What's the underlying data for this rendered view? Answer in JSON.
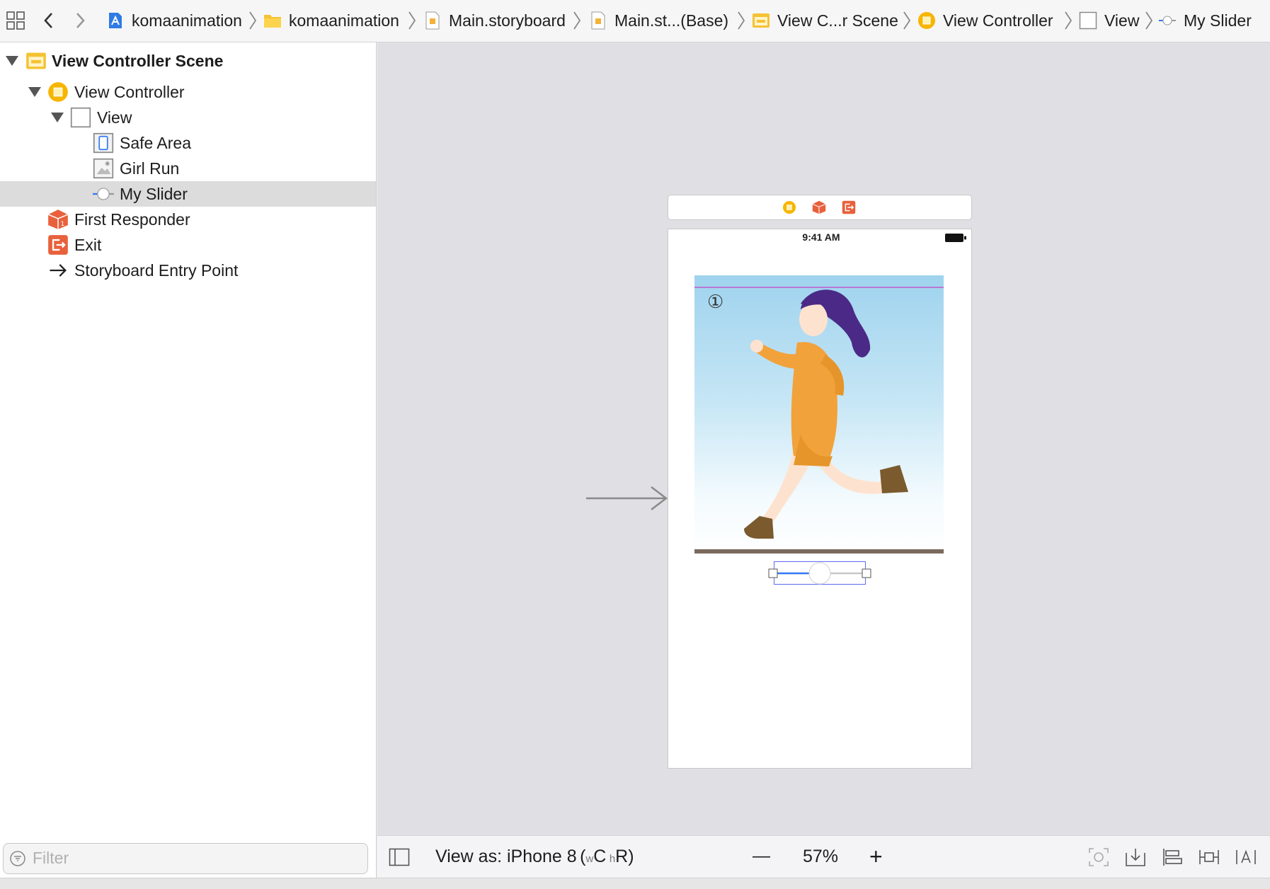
{
  "breadcrumbs": [
    {
      "label": "komaanimation",
      "icon": "xcode-project-icon"
    },
    {
      "label": "komaanimation",
      "icon": "folder-icon"
    },
    {
      "label": "Main.storyboard",
      "icon": "storyboard-file-icon"
    },
    {
      "label": "Main.st...(Base)",
      "icon": "storyboard-file-icon"
    },
    {
      "label": "View C...r Scene",
      "icon": "scene-icon"
    },
    {
      "label": "View Controller",
      "icon": "view-controller-icon"
    },
    {
      "label": "View",
      "icon": "view-icon"
    },
    {
      "label": "My Slider",
      "icon": "slider-icon"
    }
  ],
  "outline": {
    "items": [
      {
        "label": "View Controller Scene",
        "icon": "scene-icon",
        "expanded": true
      },
      {
        "label": "View Controller",
        "icon": "view-controller-icon",
        "expanded": true
      },
      {
        "label": "View",
        "icon": "view-icon",
        "expanded": true
      },
      {
        "label": "Safe Area",
        "icon": "safe-area-icon"
      },
      {
        "label": "Girl Run",
        "icon": "image-view-icon"
      },
      {
        "label": "My Slider",
        "icon": "slider-icon",
        "selected": true
      },
      {
        "label": "First Responder",
        "icon": "first-responder-icon"
      },
      {
        "label": "Exit",
        "icon": "exit-icon"
      },
      {
        "label": "Storyboard Entry Point",
        "icon": "arrow-right-icon"
      }
    ],
    "filter_placeholder": "Filter"
  },
  "canvas": {
    "status_time": "9:41 AM",
    "image_badge": "①",
    "slider_value": 0.5
  },
  "bottombar": {
    "view_as_label": "View as: iPhone 8",
    "size_class_w": "w",
    "size_class_w_value": "C",
    "size_class_h": "h",
    "size_class_h_value": "R",
    "zoom": "57%",
    "zoom_out": "—",
    "zoom_in": "+"
  },
  "colors": {
    "accent": "#3478f6",
    "vc_yellow": "#f7b500",
    "responder_orange": "#e8613c"
  }
}
